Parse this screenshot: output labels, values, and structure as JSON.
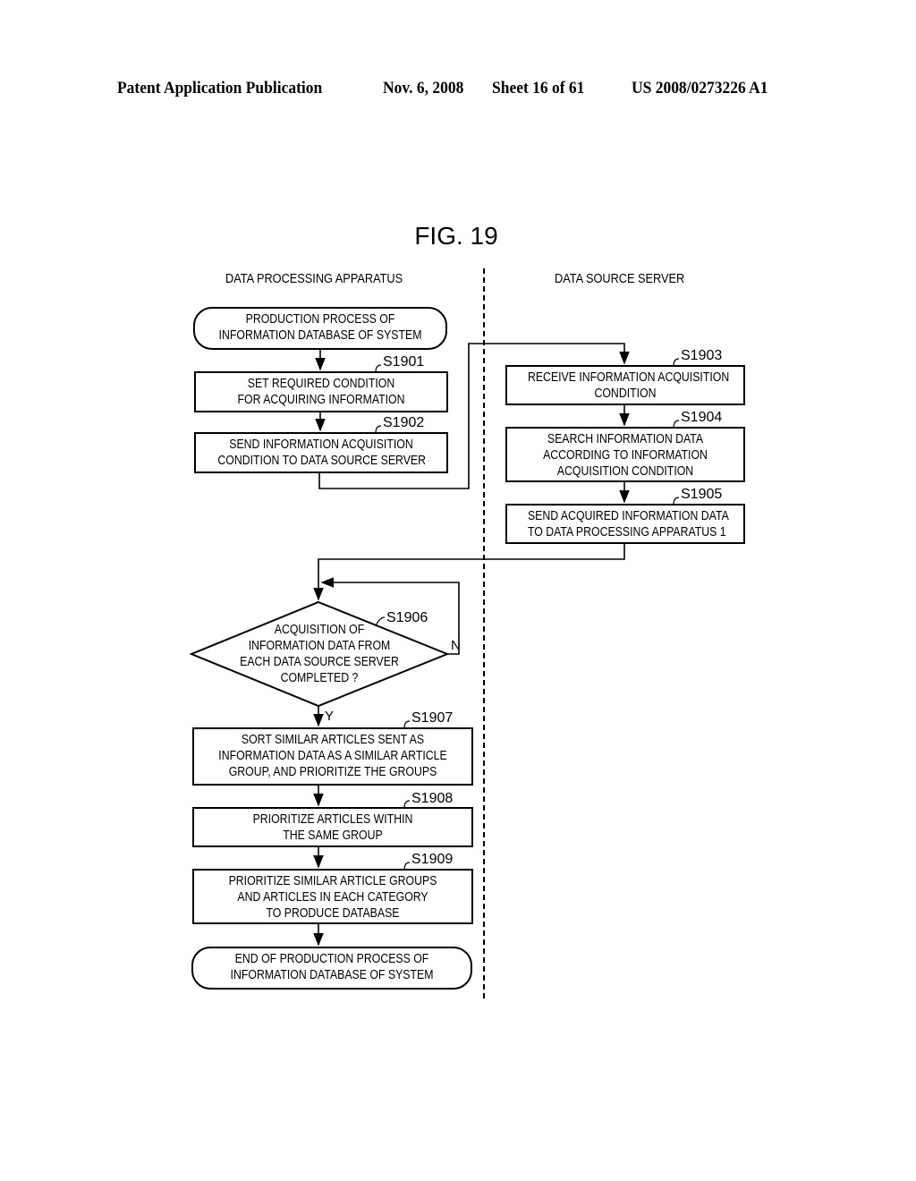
{
  "header": {
    "publication": "Patent Application Publication",
    "date": "Nov. 6, 2008",
    "sheet": "Sheet 16 of 61",
    "number": "US 2008/0273226 A1"
  },
  "figure": {
    "title": "FIG. 19",
    "lanes": {
      "left": "DATA PROCESSING APPARATUS",
      "right": "DATA SOURCE SERVER"
    },
    "start": {
      "lines": [
        "PRODUCTION PROCESS OF",
        "INFORMATION DATABASE OF SYSTEM"
      ]
    },
    "steps": {
      "s1901": {
        "label": "S1901",
        "lines": [
          "SET REQUIRED CONDITION",
          "FOR ACQUIRING INFORMATION"
        ]
      },
      "s1902": {
        "label": "S1902",
        "lines": [
          "SEND INFORMATION ACQUISITION",
          "CONDITION TO DATA SOURCE SERVER"
        ]
      },
      "s1903": {
        "label": "S1903",
        "lines": [
          "RECEIVE INFORMATION ACQUISITION",
          "CONDITION"
        ]
      },
      "s1904": {
        "label": "S1904",
        "lines": [
          "SEARCH INFORMATION DATA",
          "ACCORDING TO INFORMATION",
          "ACQUISITION CONDITION"
        ]
      },
      "s1905": {
        "label": "S1905",
        "lines": [
          "SEND ACQUIRED INFORMATION DATA",
          "TO DATA PROCESSING APPARATUS 1"
        ]
      },
      "s1906": {
        "label": "S1906",
        "lines": [
          "ACQUISITION OF",
          "INFORMATION DATA FROM",
          "EACH DATA SOURCE SERVER",
          "COMPLETED ?"
        ],
        "yes": "Y",
        "no": "N"
      },
      "s1907": {
        "label": "S1907",
        "lines": [
          "SORT SIMILAR ARTICLES SENT AS",
          "INFORMATION DATA AS A SIMILAR ARTICLE",
          "GROUP, AND PRIORITIZE THE GROUPS"
        ]
      },
      "s1908": {
        "label": "S1908",
        "lines": [
          "PRIORITIZE ARTICLES WITHIN",
          "THE SAME GROUP"
        ]
      },
      "s1909": {
        "label": "S1909",
        "lines": [
          "PRIORITIZE SIMILAR ARTICLE GROUPS",
          "AND ARTICLES IN EACH CATEGORY",
          "TO PRODUCE DATABASE"
        ]
      }
    },
    "end": {
      "lines": [
        "END OF PRODUCTION PROCESS OF",
        "INFORMATION DATABASE OF SYSTEM"
      ]
    }
  }
}
